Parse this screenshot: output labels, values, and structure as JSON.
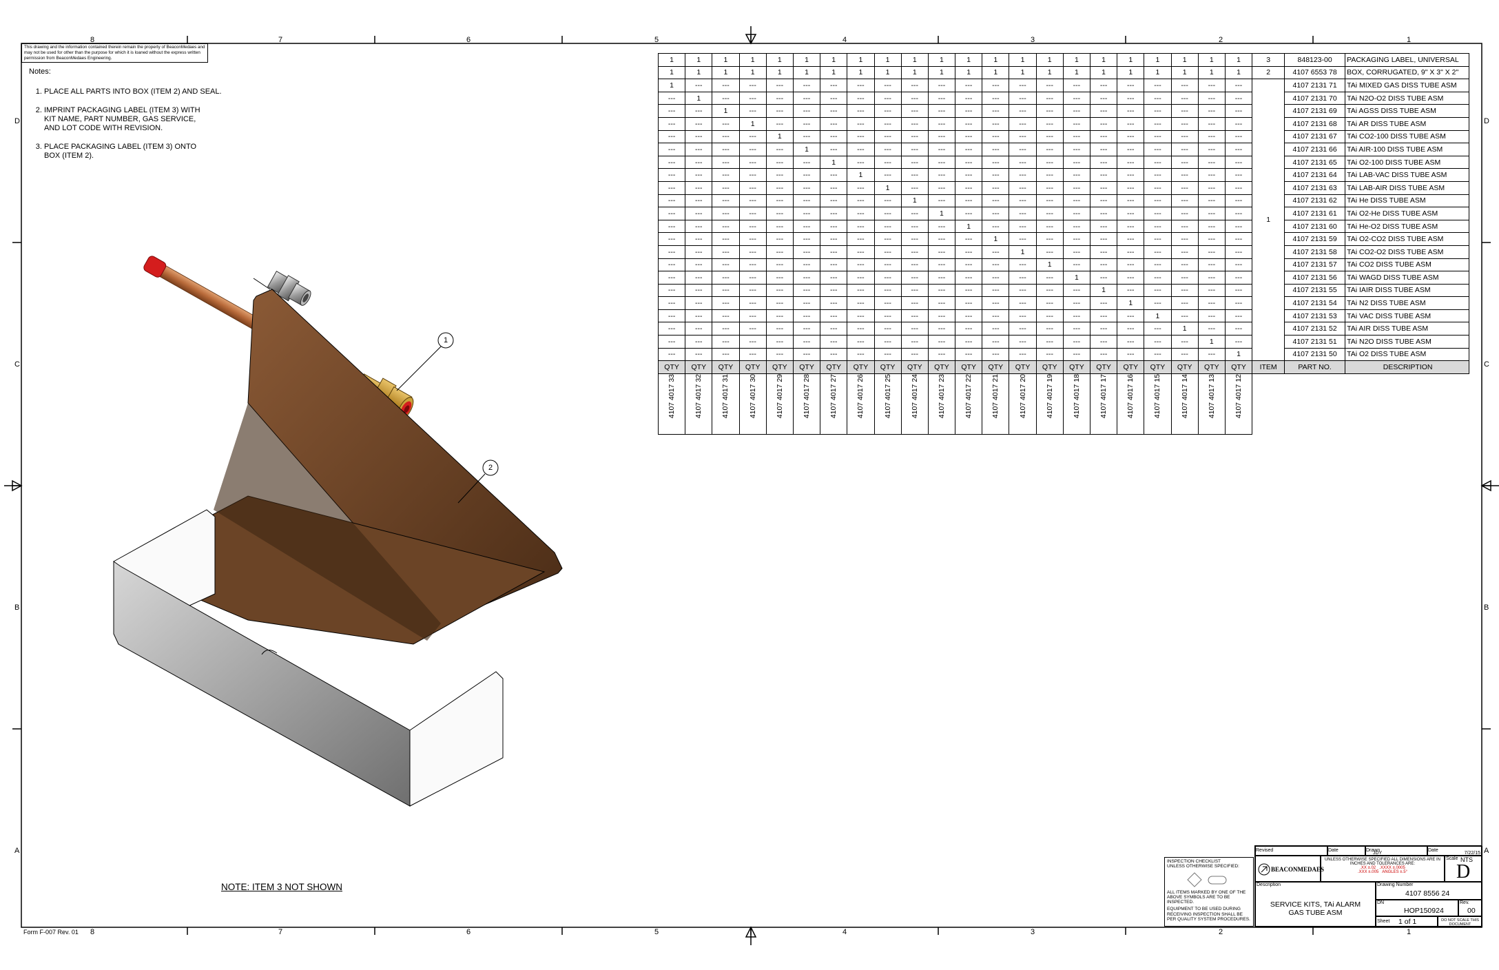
{
  "zones": {
    "columns": [
      "8",
      "7",
      "6",
      "5",
      "4",
      "3",
      "2",
      "1"
    ],
    "rows": [
      "D",
      "C",
      "B",
      "A"
    ]
  },
  "proprietary_notice": "This drawing and the information contained therein remain the property of BeaconMedaes and may not be used for other than the purpose for which it is loaned without the express written permission from BeaconMedaes Engineering.",
  "notes": {
    "title": "Notes:",
    "items": [
      "PLACE ALL PARTS INTO BOX (ITEM 2) AND SEAL.",
      "IMPRINT PACKAGING LABEL (ITEM 3) WITH\nKIT NAME, PART NUMBER, GAS SERVICE,\nAND LOT CODE WITH REVISION.",
      "PLACE PACKAGING LABEL (ITEM 3) ONTO\nBOX (ITEM 2)."
    ]
  },
  "balloons": [
    "1",
    "2"
  ],
  "note_item3": "NOTE: ITEM 3 NOT SHOWN",
  "form_rev": "Form F-007 Rev. 01",
  "bom": {
    "header": {
      "qty": "QTY",
      "item": "ITEM",
      "part_no": "PART NO.",
      "description": "DESCRIPTION"
    },
    "kit_numbers": [
      "4107 4017 33",
      "4107 4017 32",
      "4107 4017 31",
      "4107 4017 30",
      "4107 4017 29",
      "4107 4017 28",
      "4107 4017 27",
      "4107 4017 26",
      "4107 4017 25",
      "4107 4017 24",
      "4107 4017 23",
      "4107 4017 22",
      "4107 4017 21",
      "4107 4017 20",
      "4107 4017 19",
      "4107 4017 18",
      "4107 4017 17",
      "4107 4017 16",
      "4107 4017 15",
      "4107 4017 14",
      "4107 4017 13",
      "4107 4017 12"
    ],
    "dash": "---",
    "rows": [
      {
        "item": "3",
        "part_no": "848123-00",
        "description": "PACKAGING LABEL, UNIVERSAL",
        "all": "1"
      },
      {
        "item": "2",
        "part_no": "4107 6553 78",
        "description": "BOX, CORRUGATED, 9\" X 3\" X 2\"",
        "all": "1"
      },
      {
        "part_no": "4107 2131 71",
        "description": "TAi MIXED GAS DISS TUBE ASM",
        "col": 0
      },
      {
        "part_no": "4107 2131 70",
        "description": "TAi N2O-O2 DISS TUBE ASM",
        "col": 1
      },
      {
        "part_no": "4107 2131 69",
        "description": "TAi AGSS DISS TUBE ASM",
        "col": 2
      },
      {
        "part_no": "4107 2131 68",
        "description": "TAi AR DISS TUBE ASM",
        "col": 3
      },
      {
        "part_no": "4107 2131 67",
        "description": "TAi CO2-100 DISS TUBE ASM",
        "col": 4
      },
      {
        "part_no": "4107 2131 66",
        "description": "TAi AIR-100 DISS TUBE ASM",
        "col": 5
      },
      {
        "part_no": "4107 2131 65",
        "description": "TAi O2-100 DISS TUBE ASM",
        "col": 6
      },
      {
        "part_no": "4107 2131 64",
        "description": "TAi LAB-VAC DISS TUBE ASM",
        "col": 7
      },
      {
        "part_no": "4107 2131 63",
        "description": "TAi LAB-AIR DISS TUBE ASM",
        "col": 8
      },
      {
        "part_no": "4107 2131 62",
        "description": "TAi He DISS TUBE ASM",
        "col": 9
      },
      {
        "part_no": "4107 2131 61",
        "description": "TAi O2-He DISS TUBE ASM",
        "col": 10
      },
      {
        "part_no": "4107 2131 60",
        "description": "TAi He-O2 DISS TUBE ASM",
        "col": 11
      },
      {
        "part_no": "4107 2131 59",
        "description": "TAi O2-CO2 DISS TUBE ASM",
        "col": 12
      },
      {
        "part_no": "4107 2131 58",
        "description": "TAi CO2-O2 DISS TUBE ASM",
        "col": 13
      },
      {
        "part_no": "4107 2131 57",
        "description": "TAi CO2 DISS TUBE ASM",
        "col": 14
      },
      {
        "part_no": "4107 2131 56",
        "description": "TAi WAGD DISS TUBE ASM",
        "col": 15
      },
      {
        "part_no": "4107 2131 55",
        "description": "TAi IAIR DISS TUBE ASM",
        "col": 16
      },
      {
        "part_no": "4107 2131 54",
        "description": "TAi N2 DISS TUBE ASM",
        "col": 17
      },
      {
        "part_no": "4107 2131 53",
        "description": "TAi VAC DISS TUBE ASM",
        "col": 18
      },
      {
        "part_no": "4107 2131 52",
        "description": "TAi AIR DISS TUBE ASM",
        "col": 19
      },
      {
        "part_no": "4107 2131 51",
        "description": "TAi N2O DISS TUBE ASM",
        "col": 20
      },
      {
        "part_no": "4107 2131 50",
        "description": "TAi O2 DISS TUBE ASM",
        "col": 21
      }
    ],
    "merged_item": "1"
  },
  "inspection": {
    "title": "INSPECTION CHECKLIST\nUNLESS OTHERWISE SPECIFIED:",
    "text1": "ALL ITEMS MARKED BY ONE OF THE ABOVE SYMBOLS ARE TO BE INSPECTED.",
    "text2": "EQUIPMENT TO BE USED DURING RECEIVING INSPECTION SHALL BE PER QUALITY SYSTEM PROCEDURES."
  },
  "title_block": {
    "revised_label": "Revised",
    "date_label": "Date",
    "drawn_label": "Drawn",
    "drawn_value": "JDY",
    "date2_label": "Date",
    "date2_value": "7/22/15",
    "company": "BEACONMEDAES",
    "tolerances": "UNLESS OTHERWISE SPECIFIED ALL DIMENSIONS ARE IN INCHES AND TOLERANCES ARE:",
    "tol_xx": ".XX ±.02",
    "tol_xxx": ".XXX ±.005",
    "tol_xxxx": ".XXXX ±.0005",
    "tol_ang": "ANGLES ±.5°",
    "scale_label": "Scale",
    "scale_value": "NTS",
    "size_value": "D",
    "description_label": "Description",
    "description": "SERVICE KITS, TAi ALARM\nGAS TUBE ASM",
    "drawing_number_label": "Drawing Number",
    "drawing_number": "4107 8556 24",
    "dn_label": "DN",
    "dn_value": "HOP150924",
    "rev_label": "Rev.",
    "rev_value": "00",
    "sheet_label": "Sheet",
    "sheet_value": "1 of 1",
    "donot_scale": "DO NOT SCALE THIS DOCUMENT"
  }
}
